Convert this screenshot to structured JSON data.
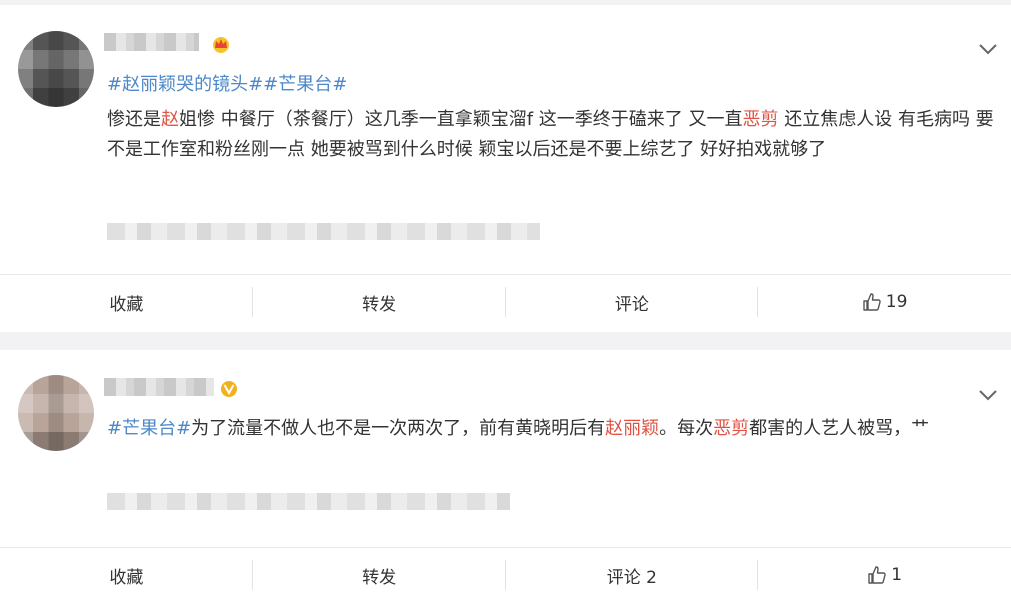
{
  "posts": [
    {
      "body_parts": [
        {
          "text": "#赵丽颖哭的镜头##芒果台#",
          "kind": "topics"
        }
      ],
      "topic1": "#赵丽颖哭的镜头#",
      "topic2": "#芒果台#",
      "body_a": "惨还是",
      "body_b": "赵",
      "body_c": "姐惨 中餐厅（茶餐厅）这几季一直拿颖宝溜f 这一季终于磕来了 又一直",
      "body_d": "恶剪",
      "body_e": " 还立焦虑人设 有毛病吗 要不是工作室和粉丝刚一点 她要被骂到什么时候 颖宝以后还是不要上综艺了 好好拍戏就够了",
      "actions": {
        "favorite": "收藏",
        "repost": "转发",
        "comment": "评论",
        "likes": "19"
      }
    },
    {
      "topic1": "#芒果台#",
      "body_a": "为了流量不做人也不是一次两次了，前有黄晓明后有",
      "body_b": "赵丽颖",
      "body_c": "。每次",
      "body_d": "恶剪",
      "body_e": "都害的人艺人被骂，艹",
      "actions": {
        "favorite": "收藏",
        "repost": "转发",
        "comment": "评论 2",
        "likes": "1"
      }
    }
  ],
  "colors": {
    "link": "#4e88c8",
    "highlight": "#e05244",
    "crown": "#e8443a",
    "vip": "#f2b01e"
  },
  "icons": [
    "crown-badge-icon",
    "verified-v-icon",
    "chevron-down-icon",
    "thumbs-up-icon"
  ]
}
